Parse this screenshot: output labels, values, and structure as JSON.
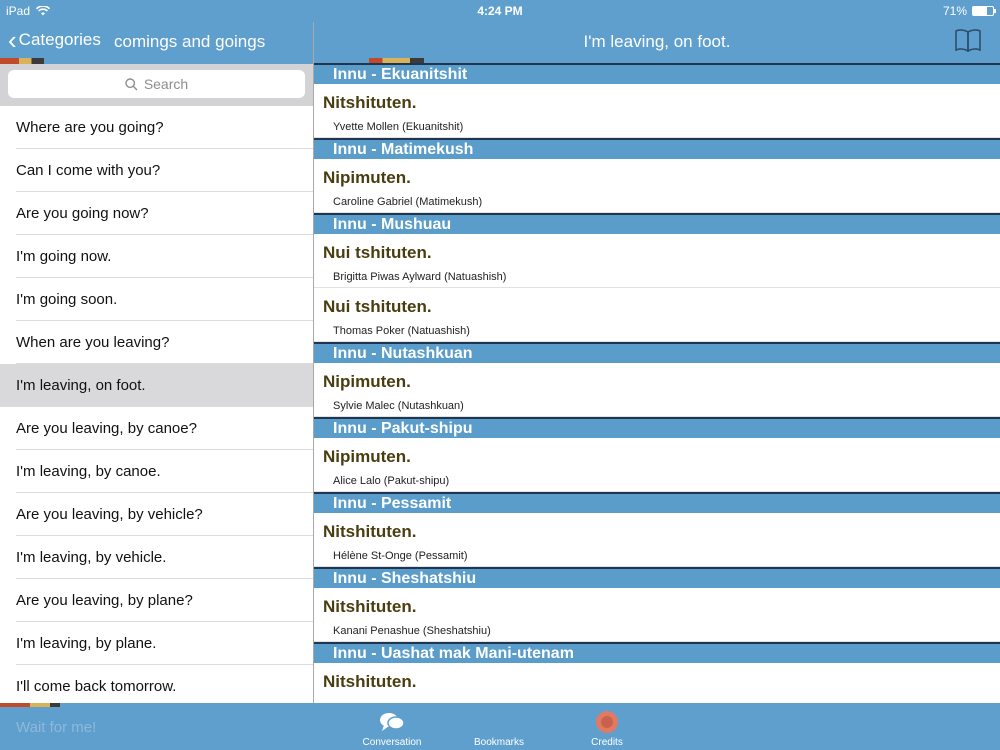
{
  "status": {
    "device": "iPad",
    "time": "4:24 PM",
    "battery": "71%",
    "battery_level": 0.71
  },
  "sidebar": {
    "back_label": "Categories",
    "title": "comings and goings",
    "search_placeholder": "Search",
    "items": [
      {
        "label": "Where are you going?"
      },
      {
        "label": "Can I come with you?"
      },
      {
        "label": "Are you going now?"
      },
      {
        "label": "I'm going now."
      },
      {
        "label": "I'm going soon."
      },
      {
        "label": "When are you leaving?"
      },
      {
        "label": "I'm leaving, on foot.",
        "selected": true
      },
      {
        "label": "Are you leaving, by canoe?"
      },
      {
        "label": "I'm leaving, by canoe."
      },
      {
        "label": "Are you leaving, by vehicle?"
      },
      {
        "label": "I'm leaving, by vehicle."
      },
      {
        "label": "Are you leaving, by plane?"
      },
      {
        "label": "I'm leaving, by plane."
      },
      {
        "label": "I'll come back tomorrow."
      }
    ],
    "next_item_partial": "Wait for me!"
  },
  "main": {
    "title": "I'm leaving, on foot.",
    "sections": [
      {
        "header": "Innu - Ekuanitshit",
        "entries": [
          {
            "phrase": "Nitshituten.",
            "speaker": "Yvette Mollen (Ekuanitshit)"
          }
        ]
      },
      {
        "header": "Innu - Matimekush",
        "entries": [
          {
            "phrase": "Nipimuten.",
            "speaker": "Caroline Gabriel (Matimekush)"
          }
        ]
      },
      {
        "header": "Innu - Mushuau",
        "entries": [
          {
            "phrase": "Nui tshituten.",
            "speaker": "Brigitta Piwas Aylward (Natuashish)"
          },
          {
            "phrase": "Nui tshituten.",
            "speaker": "Thomas Poker (Natuashish)"
          }
        ]
      },
      {
        "header": "Innu - Nutashkuan",
        "entries": [
          {
            "phrase": "Nipimuten.",
            "speaker": "Sylvie Malec (Nutashkuan)"
          }
        ]
      },
      {
        "header": "Innu - Pakut-shipu",
        "entries": [
          {
            "phrase": "Nipimuten.",
            "speaker": "Alice Lalo (Pakut-shipu)"
          }
        ]
      },
      {
        "header": "Innu - Pessamit",
        "entries": [
          {
            "phrase": "Nitshituten.",
            "speaker": "Hélène St-Onge (Pessamit)"
          }
        ]
      },
      {
        "header": "Innu - Sheshatshiu",
        "entries": [
          {
            "phrase": "Nitshituten.",
            "speaker": "Kanani Penashue (Sheshatshiu)"
          }
        ]
      },
      {
        "header": "Innu - Uashat mak Mani-utenam",
        "entries": [
          {
            "phrase": "Nitshituten.",
            "speaker": ""
          }
        ]
      }
    ]
  },
  "tabbar": {
    "tabs": [
      {
        "label": "Conversation",
        "icon": "speech-bubbles-icon"
      },
      {
        "label": "Bookmarks",
        "icon": "bookmark-icon"
      },
      {
        "label": "Credits",
        "icon": "info-icon"
      }
    ]
  },
  "colors": {
    "bar_blue": "#5f9fcd",
    "section_blue": "#5a9cca",
    "phrase_brown": "#4a3d10",
    "selected_gray": "#d9d9db"
  }
}
